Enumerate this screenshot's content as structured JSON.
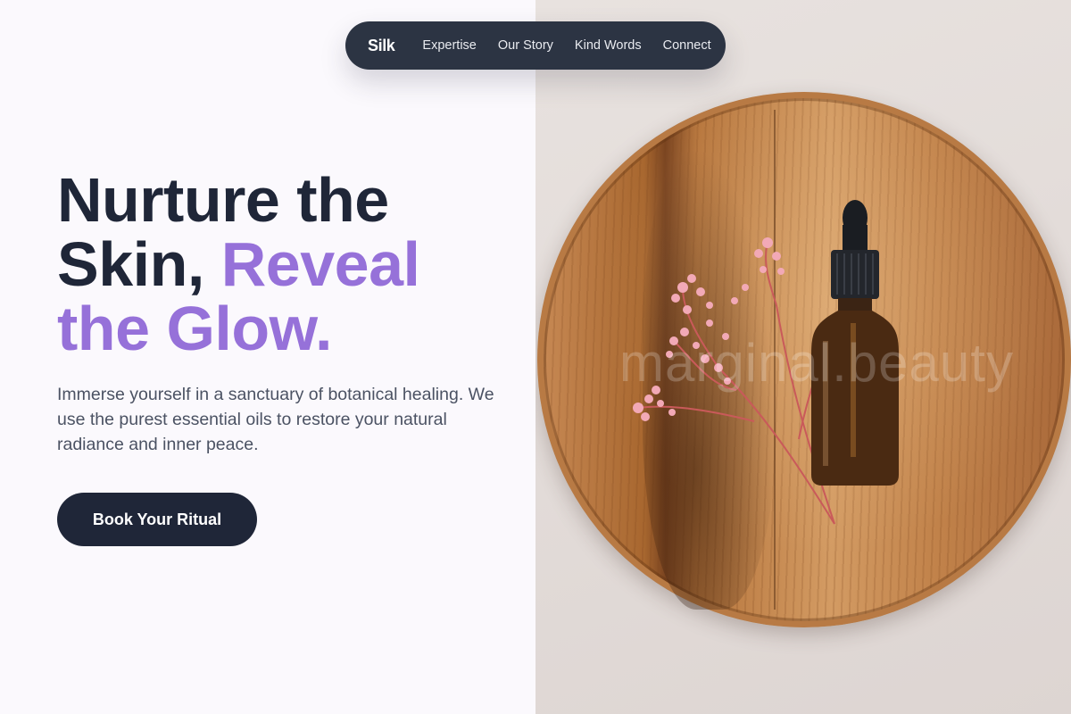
{
  "nav": {
    "logo": "Silk",
    "links": [
      "Expertise",
      "Our Story",
      "Kind Words",
      "Connect"
    ]
  },
  "hero": {
    "title_part1": "Nurture the Skin, ",
    "title_accent": "Reveal the Glow.",
    "subtitle": "Immerse yourself in a sanctuary of botanical healing. We use the purest essential oils to restore your natural radiance and inner peace.",
    "cta_label": "Book Your Ritual"
  },
  "image": {
    "watermark": "marginal.beauty",
    "icon": "serum-bottle-on-wooden-tray"
  },
  "colors": {
    "accent": "#9671d9",
    "dark": "#1f2638",
    "nav_bg": "#2c3443"
  }
}
